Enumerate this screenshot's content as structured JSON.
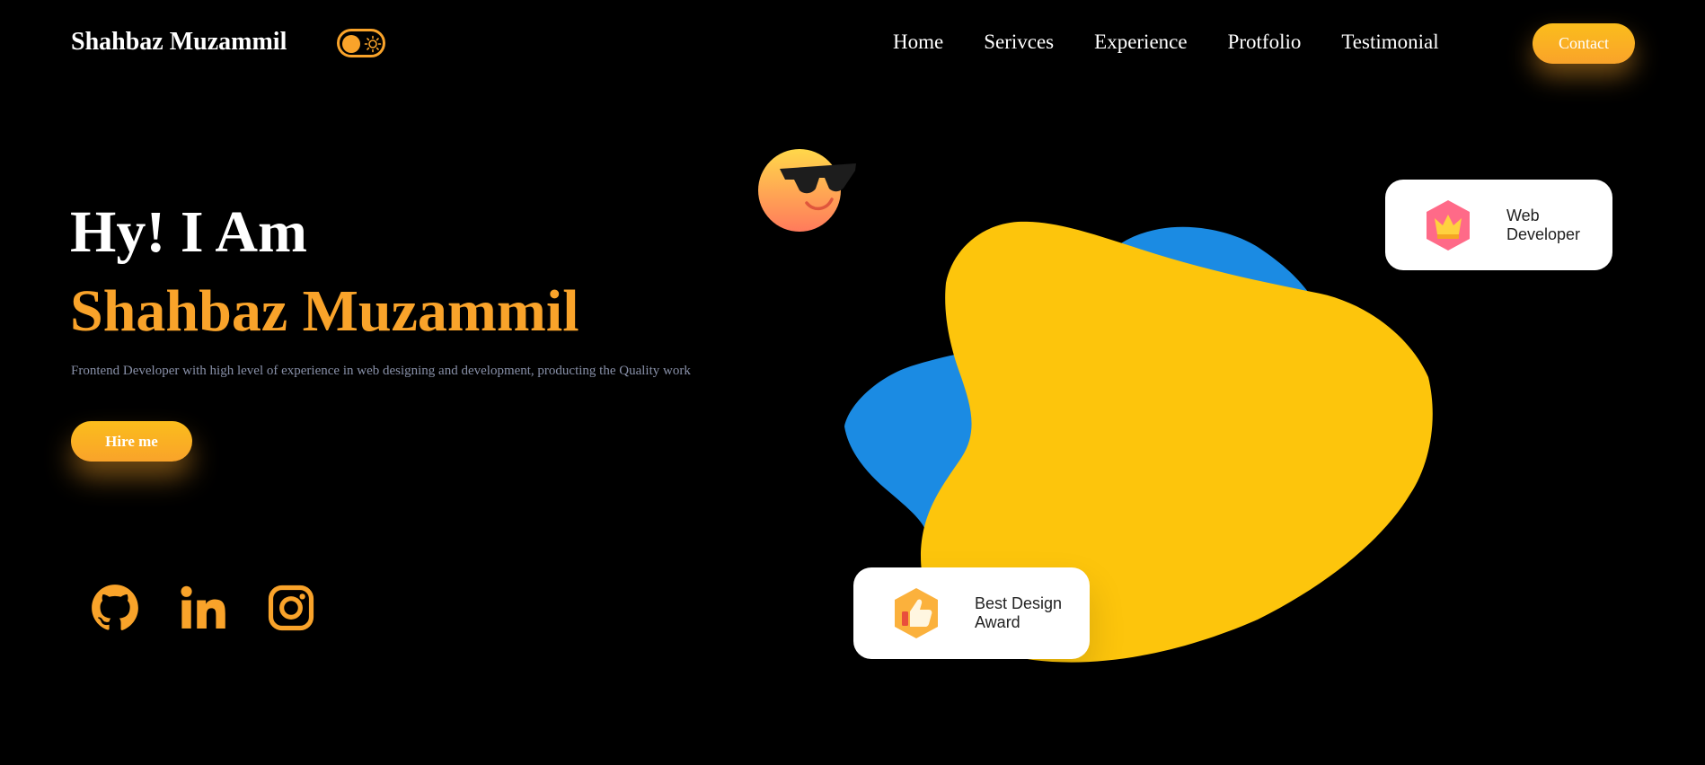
{
  "header": {
    "brand": "Shahbaz Muzammil",
    "nav": [
      "Home",
      "Serivces",
      "Experience",
      "Protfolio",
      "Testimonial"
    ],
    "contact_label": "Contact"
  },
  "hero": {
    "greeting": "Hy! I Am",
    "name": "Shahbaz Muzammil",
    "description": "Frontend Developer with high level of experience in web designing and development, producting the Quality work",
    "hire_label": "Hire me"
  },
  "social": [
    "github-icon",
    "linkedin-icon",
    "instagram-icon"
  ],
  "cards": {
    "web_line1": "Web",
    "web_line2": "Developer",
    "award_line1": "Best Design",
    "award_line2": "Award"
  },
  "colors": {
    "accent": "#f9a32a",
    "yellow": "#fdc50c",
    "blue": "#1b8be3",
    "bg": "#000000"
  }
}
